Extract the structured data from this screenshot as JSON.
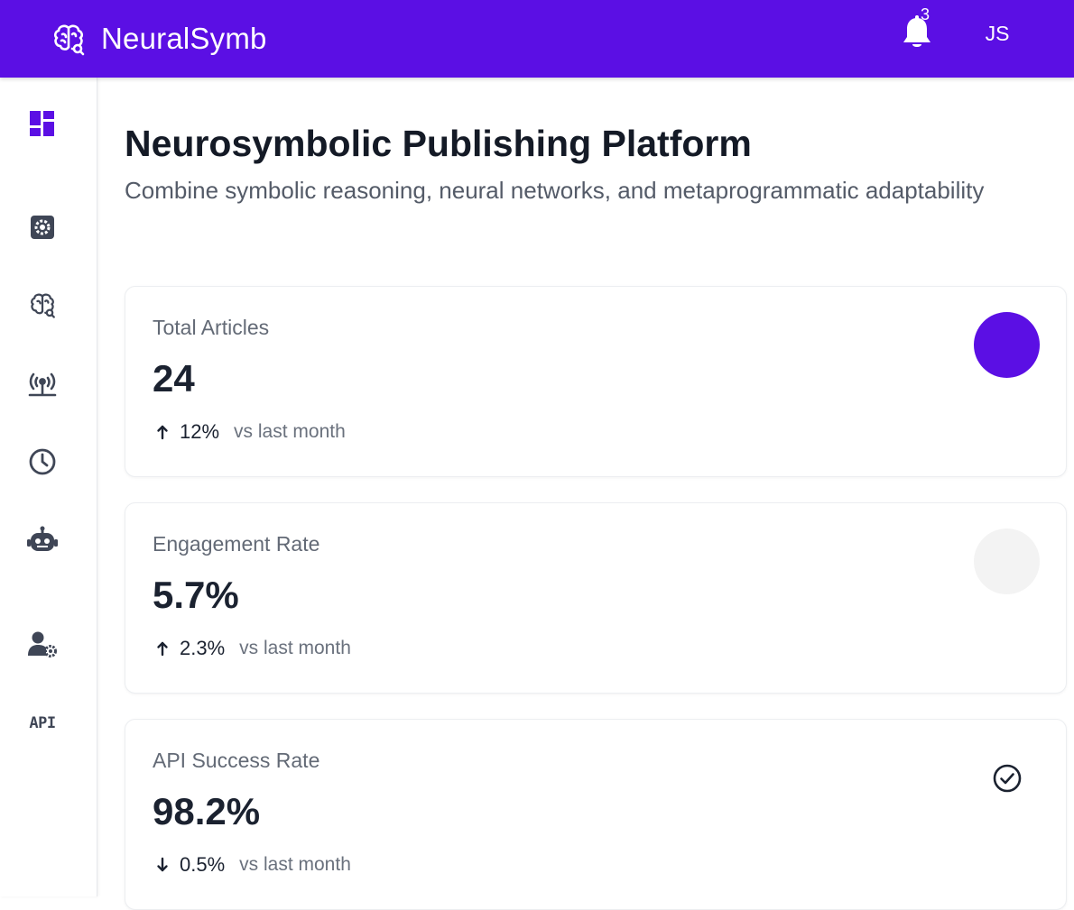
{
  "app": {
    "brand_name": "NeuralSymb",
    "brand_icon": "brain-icon",
    "accent_color": "#5b0fe4",
    "notifications": {
      "icon": "bell-icon",
      "count": "3"
    },
    "user_initials": "JS"
  },
  "sidebar": {
    "items": [
      {
        "id": "dashboard",
        "icon": "dashboard-icon",
        "active": true
      },
      {
        "id": "settings",
        "icon": "gear-icon",
        "active": false
      },
      {
        "id": "neural",
        "icon": "brain-icon",
        "active": false
      },
      {
        "id": "broadcast",
        "icon": "broadcast-tower-icon",
        "active": false
      },
      {
        "id": "history",
        "icon": "clock-icon",
        "active": false
      },
      {
        "id": "bots",
        "icon": "robot-icon",
        "active": false
      },
      {
        "id": "user-settings",
        "icon": "user-gear-icon",
        "active": false
      },
      {
        "id": "api",
        "label": "API",
        "active": false
      }
    ]
  },
  "main": {
    "title": "Neurosymbolic Publishing Platform",
    "subtitle": "Combine symbolic reasoning, neural networks, and metaprogrammatic adaptability",
    "cards": [
      {
        "label": "Total Articles",
        "value": "24",
        "trend_direction": "up",
        "trend_value": "12%",
        "trend_compare": "vs last month",
        "indicator": "filled-circle",
        "indicator_color": "#5b0fe4"
      },
      {
        "label": "Engagement Rate",
        "value": "5.7%",
        "trend_direction": "up",
        "trend_value": "2.3%",
        "trend_compare": "vs last month",
        "indicator": "filled-circle",
        "indicator_color": "#f3f3f3"
      },
      {
        "label": "API Success Rate",
        "value": "98.2%",
        "trend_direction": "down",
        "trend_value": "0.5%",
        "trend_compare": "vs last month",
        "indicator": "check-circle-icon",
        "indicator_color": "#1b2230"
      }
    ]
  }
}
